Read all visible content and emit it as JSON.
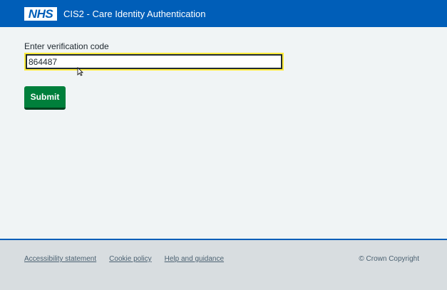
{
  "header": {
    "logo_text": "NHS",
    "title": "CIS2 - Care Identity Authentication"
  },
  "form": {
    "label": "Enter verification code",
    "code_value": "864487",
    "submit_label": "Submit"
  },
  "footer": {
    "links": [
      "Accessibility statement",
      "Cookie policy",
      "Help and guidance"
    ],
    "copyright": "© Crown Copyright"
  },
  "colors": {
    "header_bg": "#005eb8",
    "page_bg": "#f0f4f5",
    "footer_bg": "#d8dde0",
    "button_green": "#007f3b",
    "focus_yellow": "#ffeb3b"
  }
}
